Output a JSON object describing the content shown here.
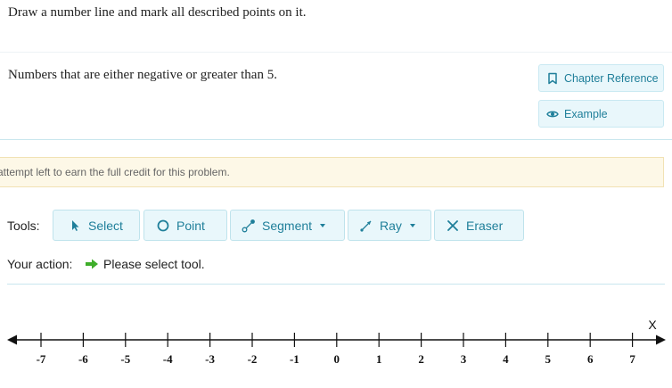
{
  "instruction": "Draw a number line and mark all described points on it.",
  "problem": "Numbers that are either negative or greater than 5.",
  "sidebar_buttons": {
    "chapter_reference": "Chapter Reference",
    "example": "Example"
  },
  "notice": "attempt left to earn the full credit for this problem.",
  "tools": {
    "label": "Tools:",
    "items": [
      {
        "label": "Select",
        "icon": "cursor-icon"
      },
      {
        "label": "Point",
        "icon": "circle-icon"
      },
      {
        "label": "Segment",
        "icon": "segment-icon",
        "dropdown": true
      },
      {
        "label": "Ray",
        "icon": "ray-icon",
        "dropdown": true
      },
      {
        "label": "Eraser",
        "icon": "x-icon"
      }
    ]
  },
  "action": {
    "label": "Your action:",
    "text": "Please select tool."
  },
  "number_line": {
    "axis_label": "X",
    "ticks": [
      "-7",
      "-6",
      "-5",
      "-4",
      "-3",
      "-2",
      "-1",
      "0",
      "1",
      "2",
      "3",
      "4",
      "5",
      "6",
      "7"
    ]
  },
  "colors": {
    "accent": "#1f7f9a",
    "button_bg": "#e9f7fb",
    "notice_bg": "#fdf8e7",
    "action_arrow": "#3fae2a"
  }
}
